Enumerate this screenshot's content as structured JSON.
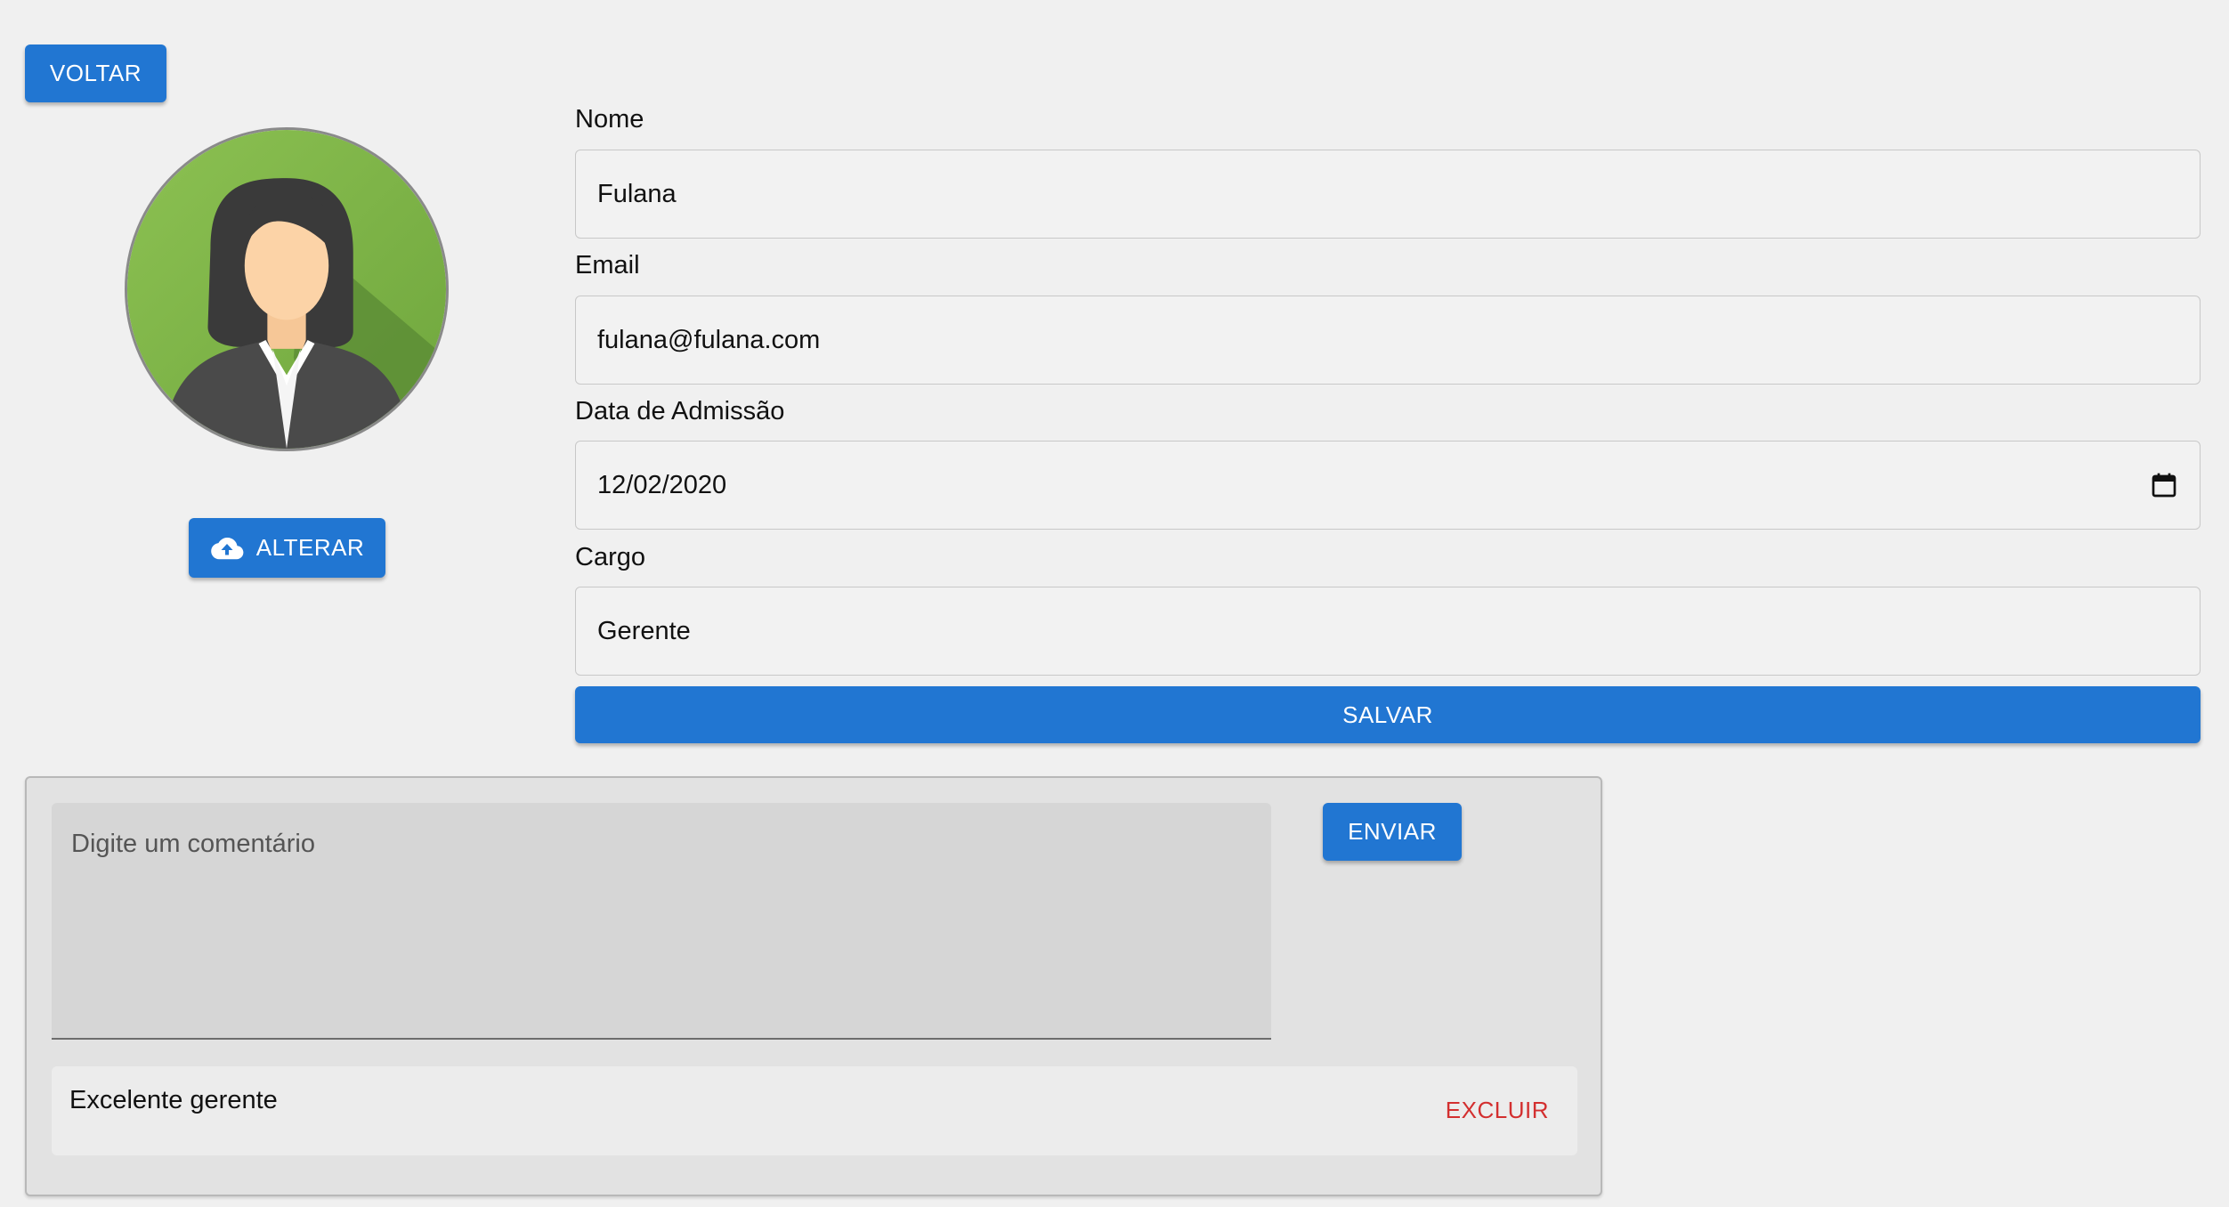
{
  "toolbar": {
    "back_label": "VOLTAR"
  },
  "profile": {
    "change_photo_label": "ALTERAR",
    "change_photo_icon": "cloud-upload-icon"
  },
  "form": {
    "name": {
      "label": "Nome",
      "value": "Fulana"
    },
    "email": {
      "label": "Email",
      "value": "fulana@fulana.com"
    },
    "admission_date": {
      "label": "Data de Admissão",
      "value": "12/02/2020",
      "icon": "calendar-icon"
    },
    "role": {
      "label": "Cargo",
      "value": "Gerente"
    },
    "save_label": "SALVAR"
  },
  "comments": {
    "input_placeholder": "Digite um comentário",
    "send_label": "ENVIAR",
    "items": [
      {
        "text": "Excelente gerente",
        "delete_label": "EXCLUIR"
      }
    ]
  },
  "colors": {
    "primary": "#2176d2",
    "danger": "#d32f2f",
    "background": "#f0f0f0"
  }
}
